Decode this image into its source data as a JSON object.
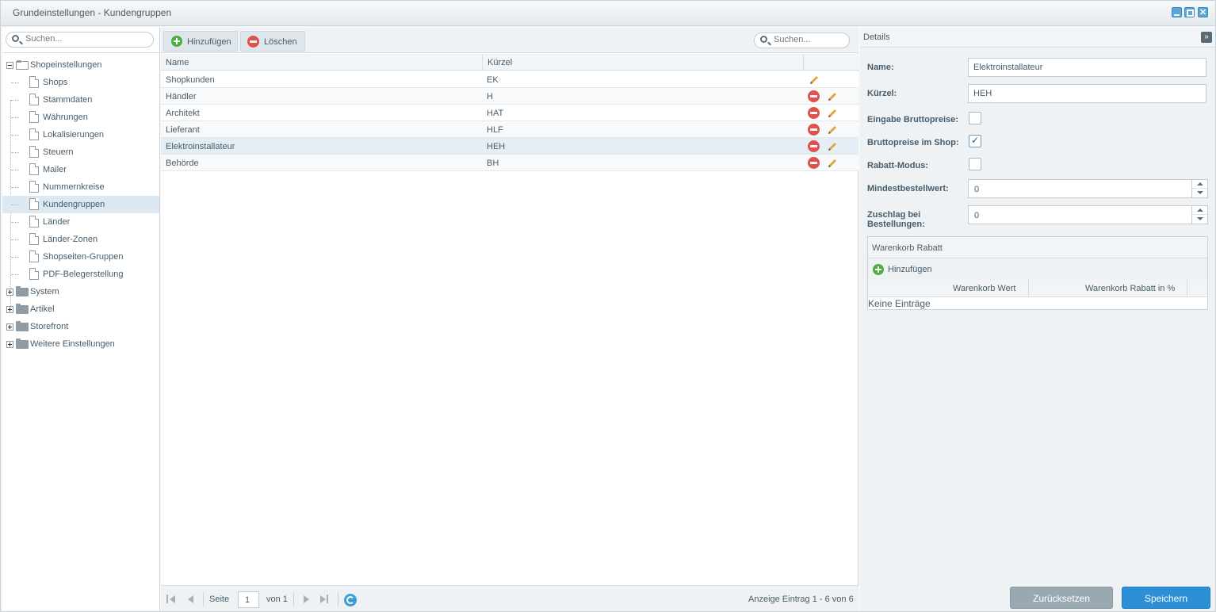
{
  "window": {
    "title": "Grundeinstellungen - Kundengruppen"
  },
  "tree": {
    "search_placeholder": "Suchen...",
    "items": [
      {
        "label": "Shopeinstellungen"
      },
      {
        "label": "Shops"
      },
      {
        "label": "Stammdaten"
      },
      {
        "label": "Währungen"
      },
      {
        "label": "Lokalisierungen"
      },
      {
        "label": "Steuern"
      },
      {
        "label": "Mailer"
      },
      {
        "label": "Nummernkreise"
      },
      {
        "label": "Kundengruppen"
      },
      {
        "label": "Länder"
      },
      {
        "label": "Länder-Zonen"
      },
      {
        "label": "Shopseiten-Gruppen"
      },
      {
        "label": "PDF-Belegerstellung"
      },
      {
        "label": "System"
      },
      {
        "label": "Artikel"
      },
      {
        "label": "Storefront"
      },
      {
        "label": "Weitere Einstellungen"
      }
    ]
  },
  "grid": {
    "add_label": "Hinzufügen",
    "delete_label": "Löschen",
    "search_placeholder": "Suchen...",
    "columns": {
      "name": "Name",
      "short": "Kürzel"
    },
    "rows": [
      {
        "name": "Shopkunden",
        "short": "EK"
      },
      {
        "name": "Händler",
        "short": "H"
      },
      {
        "name": "Architekt",
        "short": "HAT"
      },
      {
        "name": "Lieferant",
        "short": "HLF"
      },
      {
        "name": "Elektroinstallateur",
        "short": "HEH"
      },
      {
        "name": "Behörde",
        "short": "BH"
      }
    ],
    "pager": {
      "page_label": "Seite",
      "page_value": "1",
      "of_label": "von 1",
      "summary": "Anzeige Eintrag 1 - 6 von 6"
    }
  },
  "details": {
    "title": "Details",
    "collapse_glyph": "»",
    "name_label": "Name:",
    "name_value": "Elektroinstallateur",
    "short_label": "Kürzel:",
    "short_value": "HEH",
    "gross_input_label": "Eingabe Bruttopreise:",
    "gross_input_checked": false,
    "gross_shop_label": "Bruttopreise im Shop:",
    "gross_shop_checked": true,
    "discount_mode_label": "Rabatt-Modus:",
    "discount_mode_checked": false,
    "min_order_label": "Mindestbestellwert:",
    "min_order_value": "0",
    "surcharge_label_1": "Zuschlag bei",
    "surcharge_label_2": "Bestellungen:",
    "surcharge_value": "0",
    "basket": {
      "title": "Warenkorb Rabatt",
      "add_label": "Hinzufügen",
      "col_value": "Warenkorb Wert",
      "col_percent": "Warenkorb Rabatt in %",
      "empty": "Keine Einträge"
    },
    "reset_label": "Zurücksetzen",
    "save_label": "Speichern"
  },
  "colors": {
    "accent": "#2d8fd6",
    "add": "#4caf3c",
    "delete": "#e0514c",
    "edit": "#e8a23a",
    "selection": "#dde9f2"
  }
}
